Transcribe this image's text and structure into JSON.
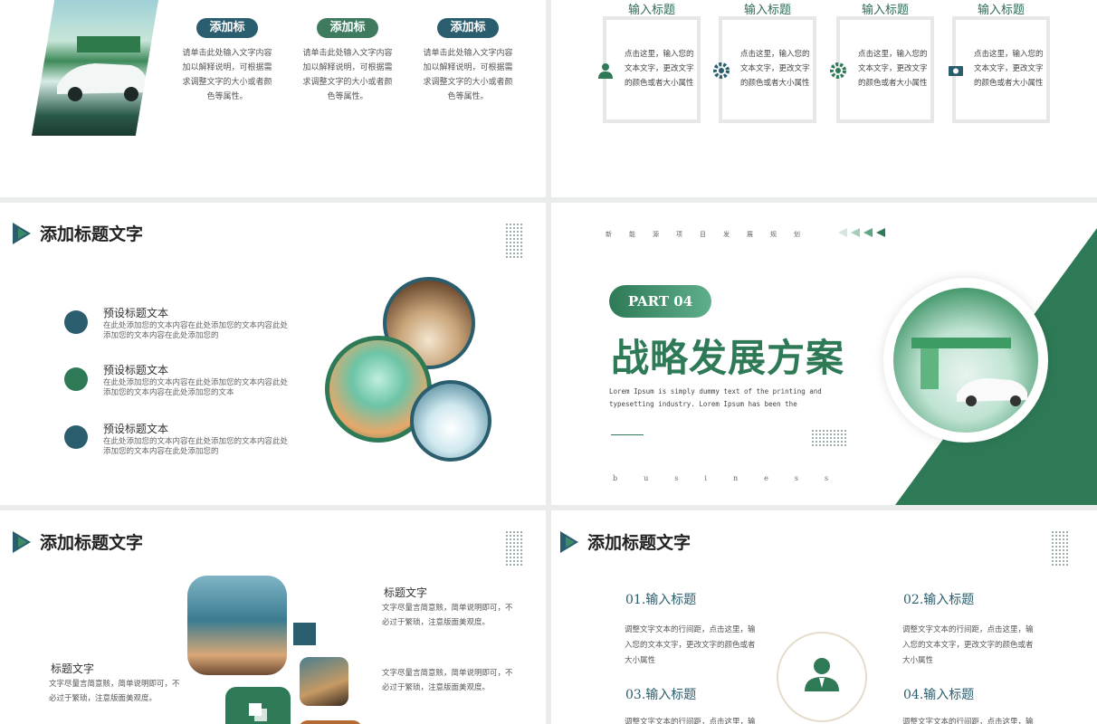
{
  "slide1": {
    "buttons": [
      "添加标题",
      "添加标题",
      "添加标题"
    ],
    "desc": "请单击此处输入文字内容加以解释说明，可根据需求调整文字的大小或者颜色等属性。",
    "colors": [
      "#2a5e6e",
      "#3d7a5e",
      "#2a5e6e"
    ]
  },
  "slide2": {
    "cards": [
      {
        "head": "输入标题",
        "text": "点击这里，输入您的文本文字，更改文字的颜色或者大小属性",
        "icon": "user-icon"
      },
      {
        "head": "输入标题",
        "text": "点击这里，输入您的文本文字，更改文字的颜色或者大小属性",
        "icon": "gear-icon"
      },
      {
        "head": "输入标题",
        "text": "点击这里，输入您的文本文字，更改文字的颜色或者大小属性",
        "icon": "gear-icon"
      },
      {
        "head": "输入标题",
        "text": "点击这里，输入您的文本文字，更改文字的颜色或者大小属性",
        "icon": "money-icon"
      }
    ]
  },
  "slide3": {
    "title": "添加标题文字",
    "items": [
      {
        "title": "预设标题文本",
        "desc": "在此处添加您的文本内容在此处添加您的文本内容此处添加您的文本内容在此处添加您的"
      },
      {
        "title": "预设标题文本",
        "desc": "在此处添加您的文本内容在此处添加您的文本内容此处添加您的文本内容在此处添加您的文本"
      },
      {
        "title": "预设标题文本",
        "desc": "在此处添加您的文本内容在此处添加您的文本内容此处添加您的文本内容在此处添加您的"
      }
    ]
  },
  "slide4": {
    "top_letters": [
      "新",
      "能",
      "源",
      "项",
      "目",
      "发",
      "展",
      "规",
      "划"
    ],
    "part": "PART 04",
    "title": "战略发展方案",
    "subtitle": "Lorem Ipsum is simply dummy text of the printing and typesetting industry. Lorem Ipsum has been the",
    "business_letters": [
      "b",
      "u",
      "s",
      "i",
      "n",
      "e",
      "s",
      "s"
    ],
    "accent": "#2e7a57"
  },
  "slide5": {
    "title": "添加标题文字",
    "left_head": "标题文字",
    "left_text": "文字尽量言简意赅，简单说明即可，不必过于繁琐，注意版面美观度。",
    "right_head": "标题文字",
    "right_text1": "文字尽量言简意赅，简单说明即可，不必过于繁琐，注意版面美观度。",
    "right_text2": "文字尽量言简意赅，简单说明即可，不必过于繁琐，注意版面美观度。"
  },
  "slide6": {
    "title": "添加标题文字",
    "items": [
      {
        "head": "01.输入标题",
        "text": "调整文字文本的行间距，点击这里，输入您的文本文字，更改文字的颜色或者大小属性"
      },
      {
        "head": "02.输入标题",
        "text": "调整文字文本的行间距，点击这里，输入您的文本文字，更改文字的颜色或者大小属性"
      },
      {
        "head": "03.输入标题",
        "text": "调整文字文本的行间距，点击这里，输入您的文本文字"
      },
      {
        "head": "04.输入标题",
        "text": "调整文字文本的行间距，点击这里，输入您的文本文字"
      }
    ]
  }
}
